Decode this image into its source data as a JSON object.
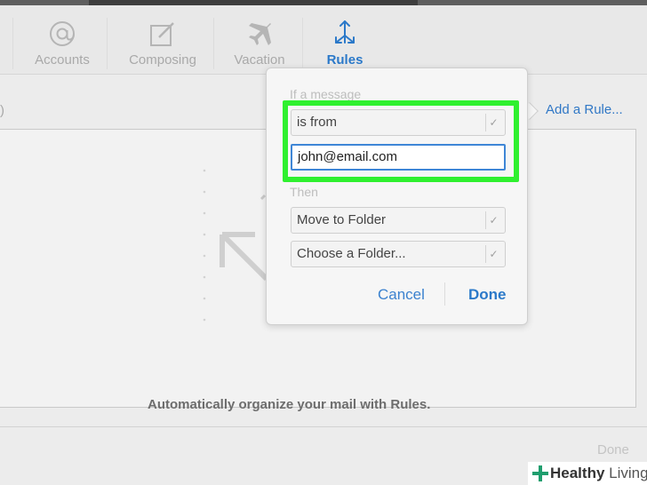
{
  "toolbar": {
    "items": [
      {
        "label": "Accounts",
        "icon": "at-icon"
      },
      {
        "label": "Composing",
        "icon": "compose-icon"
      },
      {
        "label": "Vacation",
        "icon": "airplane-icon"
      },
      {
        "label": "Rules",
        "icon": "rules-arrows-icon",
        "active": true
      }
    ]
  },
  "content": {
    "top_paren": ")",
    "add_rule": "Add a Rule...",
    "empty_text": "Automatically organize your mail with Rules.",
    "footer_done": "Done"
  },
  "popover": {
    "condition_label": "If a message",
    "condition_select": "is from",
    "email_value": "john@email.com",
    "action_label": "Then",
    "action_select": "Move to Folder",
    "folder_select": "Choose a Folder...",
    "cancel": "Cancel",
    "done": "Done"
  },
  "watermark": {
    "brand_bold": "Healthy",
    "brand_thin": "Living"
  },
  "colors": {
    "accent": "#2b79c9",
    "highlight": "#2ff02f"
  }
}
